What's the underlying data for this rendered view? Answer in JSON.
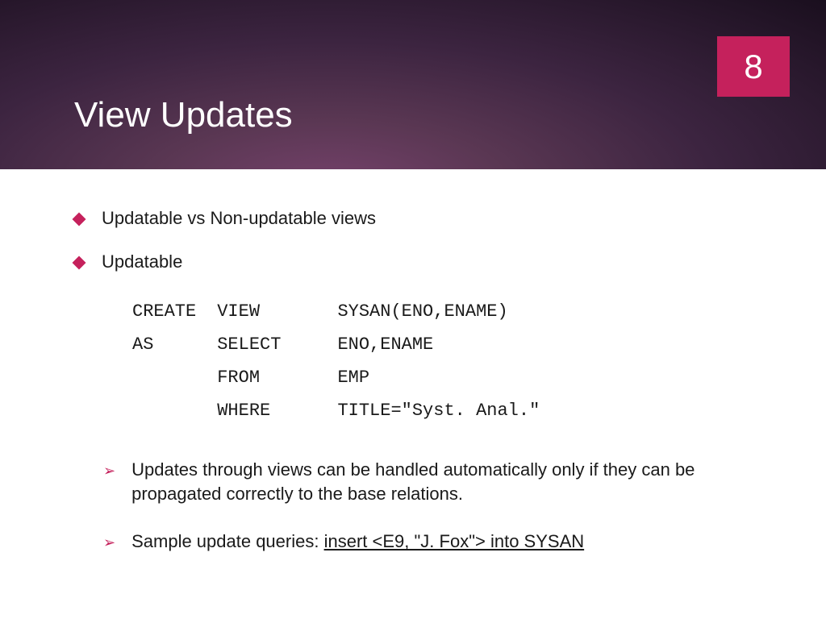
{
  "page_number": "8",
  "title": "View Updates",
  "bullets": [
    {
      "text": "Updatable vs Non-updatable views"
    },
    {
      "text": "Updatable"
    }
  ],
  "code": {
    "r1c1": "CREATE",
    "r1c2": "VIEW",
    "r1c3": "SYSAN(ENO,ENAME)",
    "r2c1": "AS",
    "r2c2": "SELECT",
    "r2c3": "ENO,ENAME",
    "r3c2": "FROM",
    "r3c3": "EMP",
    "r4c2": "WHERE",
    "r4c3": "TITLE=\"Syst. Anal.\""
  },
  "subpoints": [
    {
      "text": "Updates through views can be handled automatically only if they can be propagated correctly to the base relations."
    },
    {
      "prefix": "Sample update queries: ",
      "underlined": "insert <E9, \"J. Fox\"> into SYSAN"
    }
  ]
}
